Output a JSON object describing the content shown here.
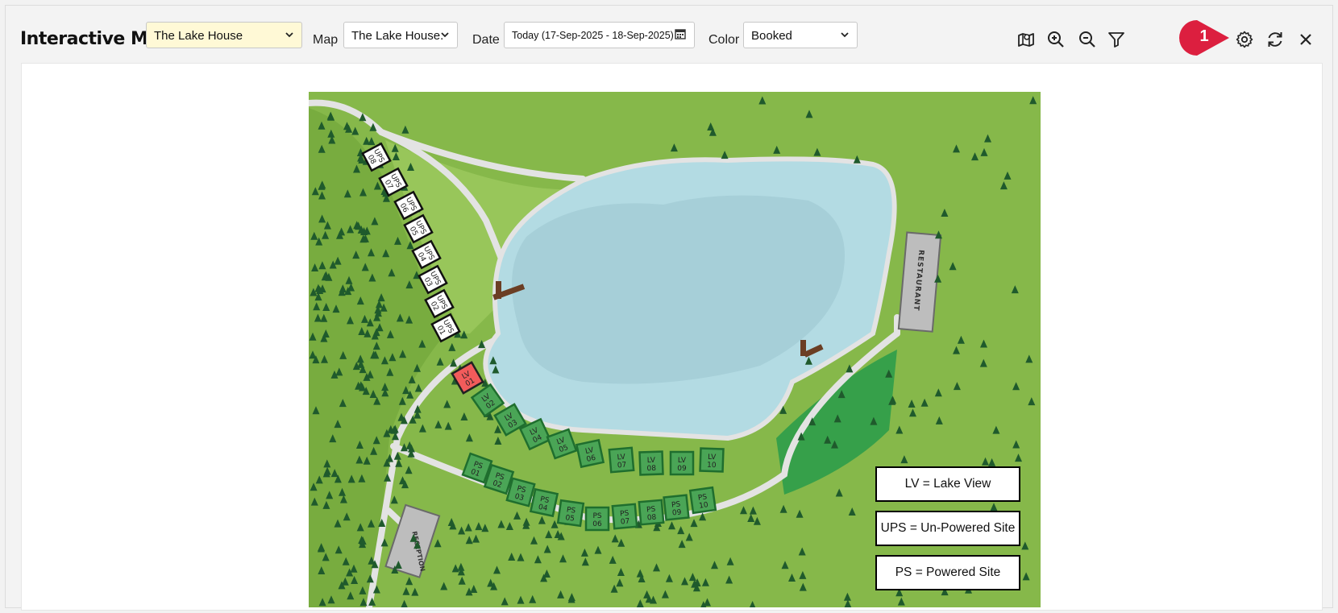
{
  "header": {
    "title": "Interactive Map",
    "property_select": {
      "value": "The Lake House"
    },
    "map_label": "Map",
    "map_select": {
      "value": "The Lake House."
    },
    "date_label": "Date",
    "date_field": {
      "value": "Today (17-Sep-2025 - 18-Sep-2025)"
    },
    "color_label": "Color",
    "color_select": {
      "value": "Booked"
    },
    "icons": [
      "map-icon",
      "zoom-in-icon",
      "zoom-out-icon",
      "filter-icon",
      "gear-icon",
      "refresh-icon",
      "close-icon"
    ],
    "step_marker": "1",
    "marker_color": "#dc1f3f"
  },
  "map": {
    "labels": {
      "restaurant": "RESTAURANT",
      "reception": "RECEPTION"
    },
    "ups_sites": [
      {
        "label": "UPS 08",
        "status": "available"
      },
      {
        "label": "UPS 07",
        "status": "available"
      },
      {
        "label": "UPS 06",
        "status": "available"
      },
      {
        "label": "UPS 05",
        "status": "available"
      },
      {
        "label": "UPS 04",
        "status": "available"
      },
      {
        "label": "UPS 03",
        "status": "available"
      },
      {
        "label": "UPS 02",
        "status": "available"
      },
      {
        "label": "UPS 01",
        "status": "available"
      }
    ],
    "lv_sites": [
      {
        "label": "LV 01",
        "status": "booked"
      },
      {
        "label": "LV 02",
        "status": "available"
      },
      {
        "label": "LV 03",
        "status": "available"
      },
      {
        "label": "LV 04",
        "status": "available"
      },
      {
        "label": "LV 05",
        "status": "available"
      },
      {
        "label": "LV 06",
        "status": "available"
      },
      {
        "label": "LV 07",
        "status": "available"
      },
      {
        "label": "LV 08",
        "status": "available"
      },
      {
        "label": "LV 09",
        "status": "available"
      },
      {
        "label": "LV 10",
        "status": "available"
      }
    ],
    "ps_sites": [
      {
        "label": "PS 01",
        "status": "available"
      },
      {
        "label": "PS 02",
        "status": "available"
      },
      {
        "label": "PS 03",
        "status": "available"
      },
      {
        "label": "PS 04",
        "status": "available"
      },
      {
        "label": "PS 05",
        "status": "available"
      },
      {
        "label": "PS 06",
        "status": "available"
      },
      {
        "label": "PS 07",
        "status": "available"
      },
      {
        "label": "PS 08",
        "status": "available"
      },
      {
        "label": "PS 09",
        "status": "available"
      },
      {
        "label": "PS 10",
        "status": "available"
      }
    ],
    "legend": [
      "LV = Lake View",
      "UPS = Un-Powered Site",
      "PS = Powered Site"
    ],
    "colors": {
      "booked": "#f25b5b",
      "available_green": "#3a9a4a",
      "available_white": "#ffffff",
      "lake": "#b3dbe3",
      "grass": "#86b84a",
      "path": "#e4e4e4"
    }
  }
}
